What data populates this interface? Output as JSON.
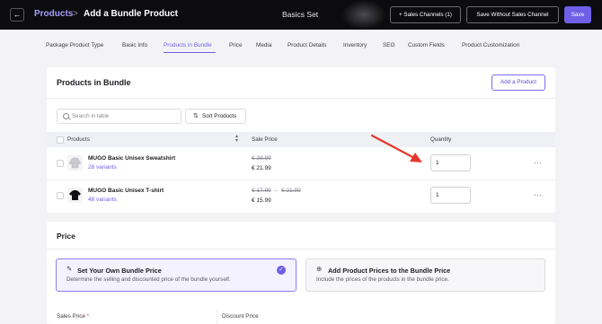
{
  "header": {
    "back_icon": "arrow-left-icon",
    "breadcrumb_root": "Products",
    "breadcrumb_sep": ">",
    "page_title": "Add a Bundle Product",
    "set_name": "Basics Set",
    "sales_channels_label": "+ Sales Channels (1)",
    "save_without_label": "Save Without Sales Channel",
    "save_label": "Save"
  },
  "tabs": [
    {
      "label": "Package Product Type"
    },
    {
      "label": "Basic Info"
    },
    {
      "label": "Products in Bundle",
      "active": true
    },
    {
      "label": "Price"
    },
    {
      "label": "Media"
    },
    {
      "label": "Product Details"
    },
    {
      "label": "Inventory"
    },
    {
      "label": "SEO"
    },
    {
      "label": "Custom Fields"
    },
    {
      "label": "Product Customization"
    }
  ],
  "bundle": {
    "title": "Products in Bundle",
    "add_product_label": "Add a Product",
    "search_placeholder": "Search in table",
    "sort_label": "Sort Products",
    "columns": {
      "products": "Products",
      "sale_price": "Sale Price",
      "quantity": "Quantity"
    },
    "rows": [
      {
        "name": "MUGO Basic Unisex Sweatshirt",
        "variants": "28 variants",
        "old_price": "€ 29.99",
        "price": "€ 21.99",
        "quantity": "1",
        "thumb_icon": "sweatshirt-icon"
      },
      {
        "name": "MUGO Basic Unisex T-shirt",
        "variants": "48 variants",
        "old_price_from": "€ 17.99",
        "old_price_dash": "–",
        "old_price_to": "€ 21.99",
        "price": "€ 15.99",
        "quantity": "1",
        "thumb_icon": "tshirt-icon"
      }
    ],
    "more_label": "···"
  },
  "price": {
    "title": "Price",
    "option1": {
      "icon": "pencil-icon",
      "title": "Set Your Own Bundle Price",
      "desc": "Determine the selling and discounted price of the bundle yourself.",
      "selected": true
    },
    "option2": {
      "icon": "plus-circle-icon",
      "title": "Add Product Prices to the Bundle Price",
      "desc": "Include the prices of the products in the bundle price."
    },
    "sales_price_label": "Sales Price",
    "required_mark": "*",
    "discount_price_label": "Discount Price"
  },
  "colors": {
    "accent": "#6f5fe6",
    "header_bg": "#0c0c0e",
    "annotation_arrow": "#e5382d"
  }
}
